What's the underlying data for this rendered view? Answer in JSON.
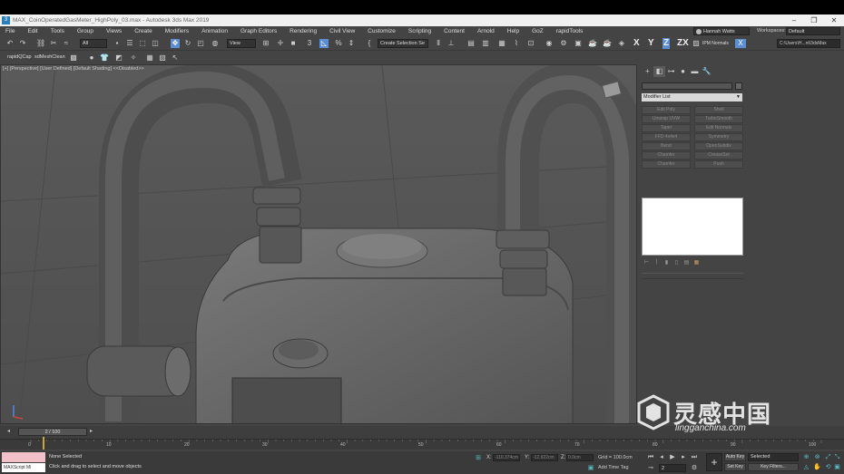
{
  "window": {
    "title": "MAX_CoinOperatedGasMeter_HighPoly_03.max - Autodesk 3ds Max 2019",
    "app_icon": "3ds-max-icon",
    "controls": [
      "minimize-icon",
      "restore-icon",
      "close-icon"
    ]
  },
  "menubar": {
    "items": [
      "File",
      "Edit",
      "Tools",
      "Group",
      "Views",
      "Create",
      "Modifiers",
      "Animation",
      "Graph Editors",
      "Rendering",
      "Civil View",
      "Customize",
      "Scripting",
      "Content",
      "Arnold",
      "Help",
      "GoZ",
      "rapidTools"
    ],
    "user": "Hannah Watts",
    "workspace_label": "Workspaces:",
    "workspace_value": "Default"
  },
  "toolbar": {
    "selection_filter": "All",
    "ref_coord": "View",
    "named_selection": "Create Selection Se",
    "axis_x": "X",
    "axis_y": "Y",
    "axis_z": "Z",
    "axis_zx": "ZX",
    "ipm_label": "IPM Normals",
    "project_path": "C:\\Users\\H...nt\\3dsMax"
  },
  "toolbar2": {
    "rapid_label": "rapidQCap",
    "mesh_label": "sdMeshClean"
  },
  "viewport": {
    "label": "[+] [Perspective] [User Defined] [Default Shading] <<Disabled>>"
  },
  "command_panel": {
    "modifier_list": "Modifier List",
    "buttons": [
      "Edit Poly",
      "Shell",
      "Unwrap UVW",
      "TurboSmooth",
      "Taper",
      "Edit Normals",
      "FFD 4x4x4",
      "Symmetry",
      "Bend",
      "OpenSubdiv",
      "Chamfer",
      "CreaseSet",
      "Chamfer",
      "Push"
    ]
  },
  "timeline": {
    "slider_text": "2 / 100",
    "ticks": [
      "0",
      "10",
      "20",
      "30",
      "40",
      "50",
      "60",
      "70",
      "80",
      "90",
      "100"
    ]
  },
  "status": {
    "maxscript": "MAXScript Mi",
    "line1": "None Selected",
    "line2": "Click and drag to select and move objects",
    "x_label": "X:",
    "y_label": "Y:",
    "z_label": "Z:",
    "x_value": "-110.374cm",
    "y_value": "-12.922cm",
    "z_value": "0.0cm",
    "grid": "Grid = 100.0cm",
    "add_time_tag": "Add Time Tag",
    "frame": "2",
    "auto_key": "Auto Key",
    "set_key": "Set Key",
    "selected": "Selected",
    "key_filters": "Key Filters..."
  },
  "watermark": {
    "chinese": "灵感中国",
    "url": "lingganchina.com"
  }
}
